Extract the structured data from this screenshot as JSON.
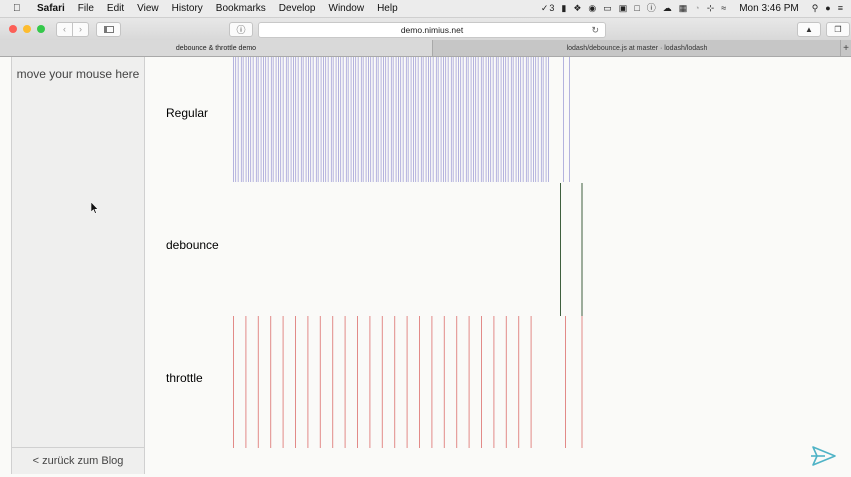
{
  "menubar": {
    "app_name": "Safari",
    "items": [
      "File",
      "Edit",
      "View",
      "History",
      "Bookmarks",
      "Develop",
      "Window",
      "Help"
    ],
    "status_count": "3",
    "clock": "Mon 3:46 PM"
  },
  "toolbar": {
    "url": "demo.nimius.net"
  },
  "tabs": [
    {
      "title": "debounce & throttle demo",
      "active": true
    },
    {
      "title": "lodash/debounce.js at master · lodash/lodash",
      "active": false
    }
  ],
  "page": {
    "hover_text": "move your mouse here",
    "back_link": "< zurück zum Blog",
    "rows": [
      {
        "key": "regular",
        "label": "Regular",
        "color": "#a7a6d9"
      },
      {
        "key": "debounce",
        "label": "debounce",
        "color": "#3e5f3e"
      },
      {
        "key": "throttle",
        "label": "throttle",
        "color": "#e28a88"
      }
    ],
    "event_counts": {
      "regular": "many",
      "debounce": 2,
      "throttle": 27
    }
  }
}
